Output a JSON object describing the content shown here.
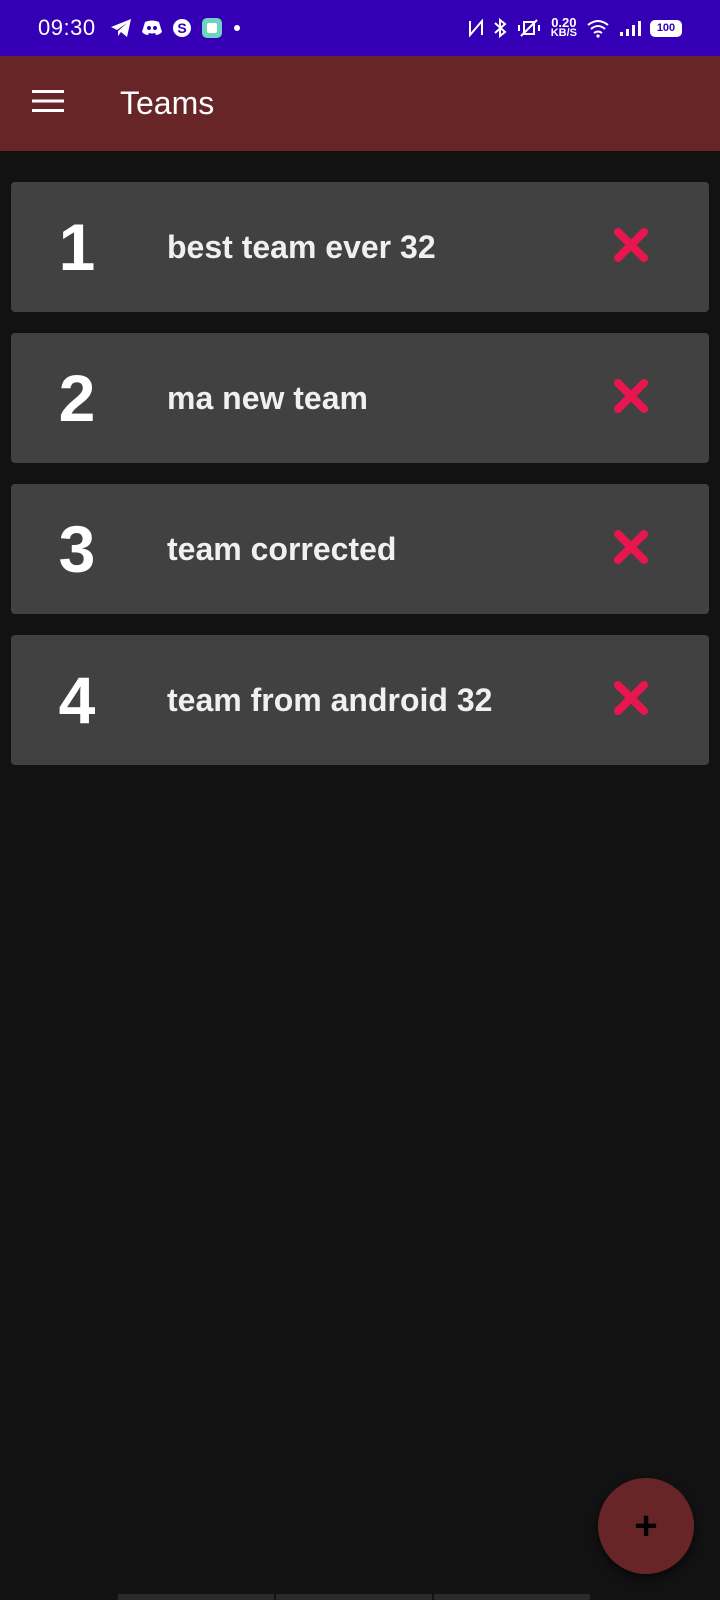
{
  "status_bar": {
    "time": "09:30",
    "left_icons": [
      "telegram-icon",
      "discord-icon",
      "skype-icon",
      "app-icon",
      "dot-icon"
    ],
    "net_speed_value": "0.20",
    "net_speed_unit": "KB/S",
    "battery": "100"
  },
  "app_bar": {
    "title": "Teams"
  },
  "teams": [
    {
      "number": "1",
      "name": "best team ever 32"
    },
    {
      "number": "2",
      "name": "ma new team"
    },
    {
      "number": "3",
      "name": "team corrected"
    },
    {
      "number": "4",
      "name": "team from android 32"
    }
  ],
  "fab": {
    "label": "+"
  },
  "colors": {
    "status_bar": "#3500b5",
    "app_bar": "#672528",
    "card": "#414141",
    "background": "#121212",
    "delete": "#e8154f"
  }
}
